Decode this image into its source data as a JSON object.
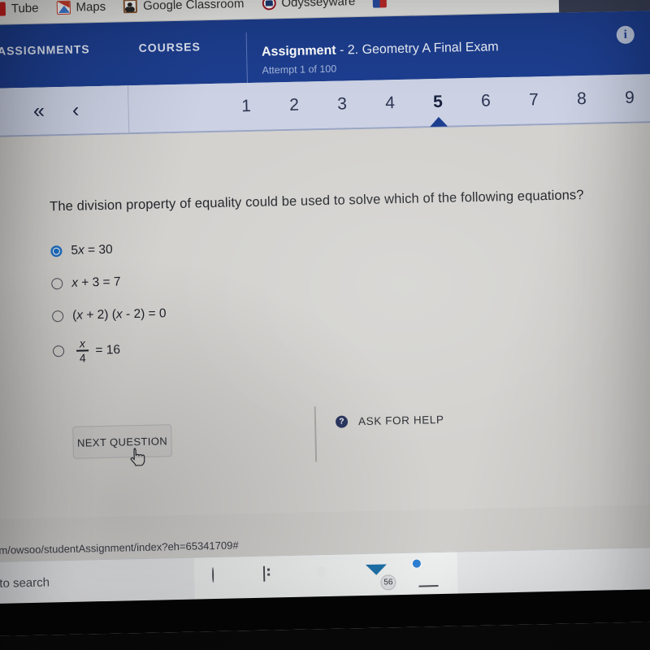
{
  "browser": {
    "bookmarks": [
      {
        "label": "Tube",
        "icon": "youtube-icon"
      },
      {
        "label": "Maps",
        "icon": "maps-icon"
      },
      {
        "label": "Google Classroom",
        "icon": "classroom-icon"
      },
      {
        "label": "Odysseyware",
        "icon": "odysseyware-icon"
      },
      {
        "label": "",
        "icon": "flag-icon"
      }
    ],
    "status_url": "m/owsoo/studentAssignment/index?eh=65341709#"
  },
  "header": {
    "nav": [
      {
        "label": "ASSIGNMENTS"
      },
      {
        "label": "COURSES"
      }
    ],
    "assignment_label": "Assignment",
    "assignment_name": " - 2. Geometry A Final Exam",
    "attempt": "Attempt 1 of 100",
    "info_icon": "info-icon",
    "info_glyph": "i",
    "accent_color": "#1d3e8f"
  },
  "qbar": {
    "first_glyph": "«",
    "prev_glyph": "‹",
    "numbers": [
      "1",
      "2",
      "3",
      "4",
      "5",
      "6",
      "7",
      "8",
      "9"
    ],
    "active_index": 4
  },
  "question": {
    "text": "The division property of equality could be used to solve which of the following equations?",
    "selected_index": 0,
    "answers": [
      {
        "id": "a",
        "selected": true,
        "plain": "5x = 30",
        "type": "text",
        "lead": "5",
        "var": "x",
        "tail": " = 30"
      },
      {
        "id": "b",
        "selected": false,
        "plain": "x + 3 = 7",
        "type": "text",
        "lead": "",
        "var": "x",
        "tail": " + 3 = 7"
      },
      {
        "id": "c",
        "selected": false,
        "plain": "(x + 2) (x - 2) = 0",
        "type": "text",
        "lead": "",
        "var": "",
        "tail": ""
      },
      {
        "id": "d",
        "selected": false,
        "plain": "x/4 = 16",
        "type": "fraction",
        "numerator": "x",
        "denominator": "4",
        "tail": " = 16"
      }
    ]
  },
  "actions": {
    "next_label": "NEXT QUESTION",
    "help_label": "ASK FOR HELP",
    "help_icon": "question-mark-icon",
    "help_glyph": "?"
  },
  "taskbar": {
    "search_text": "to search",
    "items": [
      {
        "name": "cortana-icon",
        "badge": ""
      },
      {
        "name": "task-view-icon",
        "badge": ""
      },
      {
        "name": "edge-icon",
        "badge": ""
      },
      {
        "name": "mail-icon",
        "badge": "56"
      },
      {
        "name": "chrome-icon",
        "badge": ""
      }
    ]
  }
}
